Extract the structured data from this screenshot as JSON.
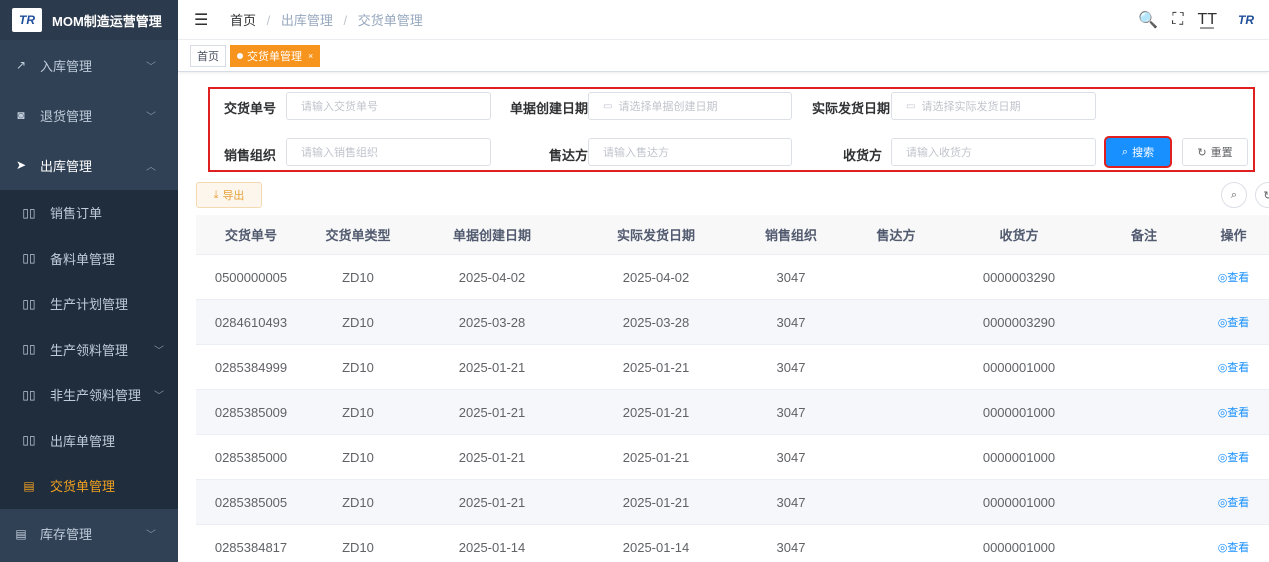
{
  "app": {
    "title": "MOM制造运营管理",
    "logo_text": "TR"
  },
  "sidebar": {
    "menus": [
      {
        "label": "入库管理",
        "icon": "external-link-icon",
        "glyph": "↗",
        "chevron": "﹀"
      },
      {
        "label": "退货管理",
        "icon": "return-icon",
        "glyph": "◙",
        "chevron": "﹀"
      },
      {
        "label": "出库管理",
        "icon": "send-icon",
        "glyph": "➤",
        "chevron": "︿"
      }
    ],
    "sub_items": [
      {
        "label": "销售订单",
        "icon": "book-icon",
        "glyph": "▯▯"
      },
      {
        "label": "备料单管理",
        "icon": "book-icon",
        "glyph": "▯▯"
      },
      {
        "label": "生产计划管理",
        "icon": "book-icon",
        "glyph": "▯▯"
      },
      {
        "label": "生产领料管理",
        "icon": "book-icon",
        "glyph": "▯▯",
        "chevron": "﹀"
      },
      {
        "label": "非生产领料管理",
        "icon": "book-icon",
        "glyph": "▯▯",
        "chevron": "﹀"
      },
      {
        "label": "出库单管理",
        "icon": "book-icon",
        "glyph": "▯▯"
      },
      {
        "label": "交货单管理",
        "icon": "table-icon",
        "glyph": "▤"
      }
    ],
    "bottom_menu": {
      "label": "库存管理",
      "icon": "table-icon",
      "glyph": "▤",
      "chevron": "﹀"
    }
  },
  "topbar": {
    "hamburger": "☰",
    "breadcrumb": [
      "首页",
      "出库管理",
      "交货单管理"
    ],
    "separator": "/",
    "icons": {
      "search": "🔍",
      "fullscreen": "⛶",
      "font": "T͟T",
      "logo": "TR"
    }
  },
  "tags": [
    {
      "label": "首页"
    },
    {
      "label": "交货单管理",
      "close": "×"
    }
  ],
  "search_form": {
    "fields": [
      {
        "label": "交货单号",
        "placeholder": "请输入交货单号"
      },
      {
        "label": "单据创建日期",
        "placeholder": "请选择单据创建日期",
        "calendar": "▭"
      },
      {
        "label": "实际发货日期",
        "placeholder": "请选择实际发货日期",
        "calendar": "▭"
      },
      {
        "label": "销售组织",
        "placeholder": "请输入销售组织"
      },
      {
        "label": "售达方",
        "placeholder": "请输入售达方"
      },
      {
        "label": "收货方",
        "placeholder": "请输入收货方"
      }
    ],
    "search_label": "搜索",
    "search_glyph": "⌕",
    "reset_label": "重置",
    "reset_glyph": "↻"
  },
  "toolbar": {
    "export_label": "导出",
    "export_glyph": "⤓",
    "search_toggle": "⌕",
    "refresh": "↻"
  },
  "table": {
    "columns": [
      "交货单号",
      "交货单类型",
      "单据创建日期",
      "实际发货日期",
      "销售组织",
      "售达方",
      "收货方",
      "备注",
      "操作"
    ],
    "view_label": "查看",
    "view_glyph": "◎",
    "rows": [
      [
        "0500000005",
        "ZD10",
        "2025-04-02",
        "2025-04-02",
        "3047",
        "",
        "0000003290",
        ""
      ],
      [
        "0284610493",
        "ZD10",
        "2025-03-28",
        "2025-03-28",
        "3047",
        "",
        "0000003290",
        ""
      ],
      [
        "0285384999",
        "ZD10",
        "2025-01-21",
        "2025-01-21",
        "3047",
        "",
        "0000001000",
        ""
      ],
      [
        "0285385009",
        "ZD10",
        "2025-01-21",
        "2025-01-21",
        "3047",
        "",
        "0000001000",
        ""
      ],
      [
        "0285385000",
        "ZD10",
        "2025-01-21",
        "2025-01-21",
        "3047",
        "",
        "0000001000",
        ""
      ],
      [
        "0285385005",
        "ZD10",
        "2025-01-21",
        "2025-01-21",
        "3047",
        "",
        "0000001000",
        ""
      ],
      [
        "0285384817",
        "ZD10",
        "2025-01-14",
        "2025-01-14",
        "3047",
        "",
        "0000001000",
        ""
      ]
    ]
  },
  "colors": {
    "sidebar_bg": "#304156",
    "accent_orange": "#f7941d",
    "primary_blue": "#1890ff",
    "highlight_red": "#e02020"
  }
}
